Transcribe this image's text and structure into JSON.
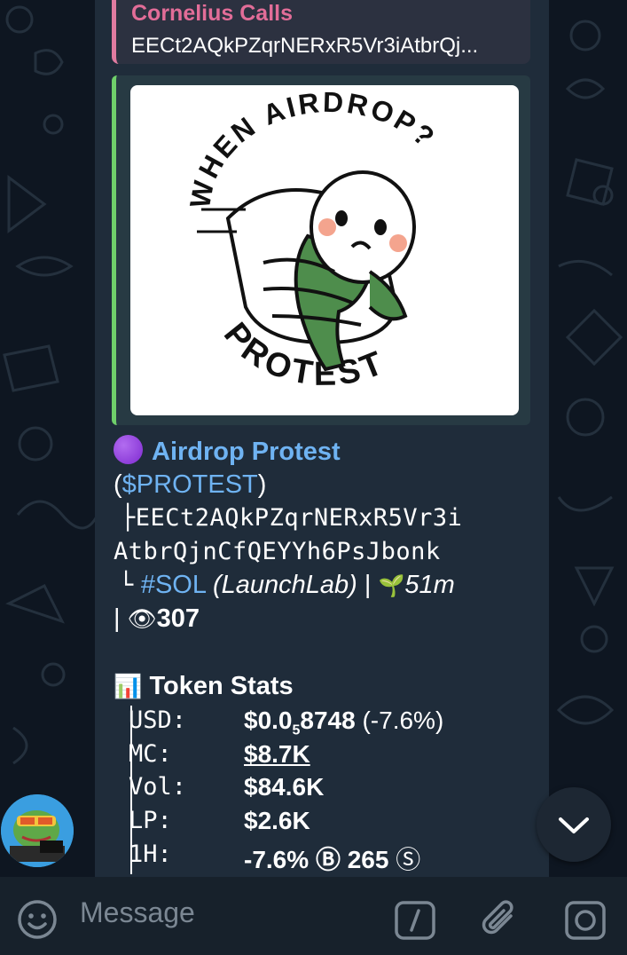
{
  "reply": {
    "sender": "Cornelius Calls",
    "text": "EECt2AQkPZqrNERxR5Vr3iAtbrQj..."
  },
  "preview": {
    "top_text": "WHEN AIRDROP?",
    "bottom_text": "PROTEST"
  },
  "message": {
    "emoji_title": "🟣",
    "token_name": "Airdrop Protest",
    "ticker_open": "(",
    "ticker": "$PROTEST",
    "ticker_close": ")",
    "address_prefix_1": "├",
    "address_line_1": "EECt2AQkPZqrNERxR5Vr3i",
    "address_line_2": "AtbrQjnCfQEYYh6PsJbonk",
    "chain_prefix": "└",
    "chain_tag": "#SOL",
    "launchpad": "(LaunchLab)",
    "separator": "|",
    "age_emoji": "🌱",
    "age": "51m",
    "views_sep": "|",
    "views_emoji": "👁",
    "views": "307",
    "stats_emoji": "📊",
    "stats_title": "Token Stats",
    "stats": [
      {
        "key": "USD:",
        "value": "$0.0",
        "sub": "5",
        "value2": "8748",
        "delta": "(-7.6%)"
      },
      {
        "key": "MC:",
        "value": "$8.7K"
      },
      {
        "key": "Vol:",
        "value": "$84.6K"
      },
      {
        "key": "LP:",
        "value": "$2.6K"
      },
      {
        "key": "1H:",
        "value": "-7.6%",
        "buy_icon": "Ⓑ",
        "count": "265",
        "sell_icon": "Ⓢ"
      }
    ]
  },
  "input": {
    "placeholder": "Message"
  },
  "icons": [
    "emoji-icon",
    "command-icon",
    "attach-icon",
    "camera-icon",
    "scroll-down-icon"
  ],
  "colors": {
    "background": "#0e1621",
    "bubble": "#1f2c3a",
    "link": "#6fb3f2",
    "reply_accent": "#e07ba0",
    "preview_accent": "#6fcf6a"
  }
}
